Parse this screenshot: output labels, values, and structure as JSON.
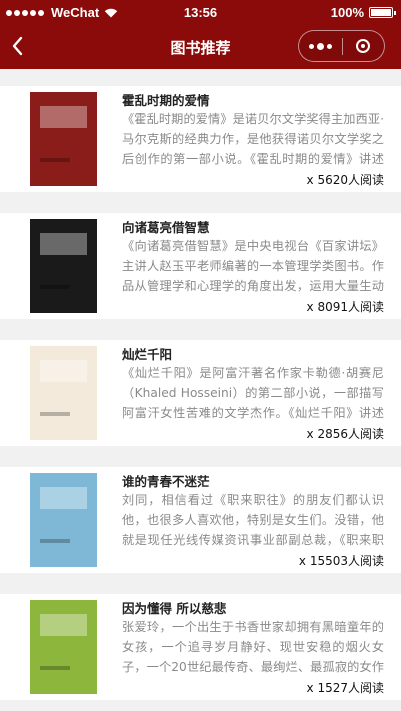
{
  "status_bar": {
    "carrier": "WeChat",
    "time": "13:56",
    "battery": "100%",
    "battery_level": 1.0,
    "signal_bars": 5
  },
  "nav": {
    "title": "图书推荐",
    "back_icon": "chevron-left-icon",
    "more_icon": "more-dots-icon",
    "close_icon": "target-circle-icon"
  },
  "colors": {
    "brand": "#8b0a0a",
    "desc_text": "#8a8a8a",
    "divider": "#f1f1f1"
  },
  "books": [
    {
      "title": "霍乱时期的爱情",
      "description": "《霍乱时期的爱情》是诺贝尔文学奖得主加西亚·马尔克斯的经典力作，是他获得诺贝尔文学奖之后创作的第一部小说。《霍乱时期的爱情》讲述了一段跨越半个多世纪的爱情史诗",
      "reads": "x 5620人阅读",
      "cover_color": "#8a1c1a"
    },
    {
      "title": "向诸葛亮借智慧",
      "description": "《向诸葛亮借智慧》是中央电视台《百家讲坛》主讲人赵玉平老师编著的一本管理学类图书。作品从管理学和心理学的角度出发，运用大量生动鲜活的案例",
      "reads": "x 8091人阅读",
      "cover_color": "#1a1a1a"
    },
    {
      "title": "灿烂千阳",
      "description": "《灿烂千阳》是阿富汗著名作家卡勒德·胡赛尼（Khaled Hosseini）的第二部小说，一部描写阿富汗女性苦难的文学杰作。《灿烂千阳》讲述了两个阿富汗女性的故事",
      "reads": "x 2856人阅读",
      "cover_color": "#f3eadb"
    },
    {
      "title": "谁的青春不迷茫",
      "description": "刘同，相信看过《职来职往》的朋友们都认识他，也很多人喜欢他，特别是女生们。没错，他就是现任光线传媒资讯事业部副总裁，《职来职往》的职场达人之一",
      "reads": "x 15503人阅读",
      "cover_color": "#7fb8d6"
    },
    {
      "title": "因为懂得 所以慈悲",
      "description": "张爱玲，一个出生于书香世家却拥有黑暗童年的女孩，一个追寻岁月静好、现世安稳的烟火女子，一个20世纪最传奇、最绚烂、最孤寂的女作家",
      "reads": "x 1527人阅读",
      "cover_color": "#8cb63c"
    }
  ]
}
